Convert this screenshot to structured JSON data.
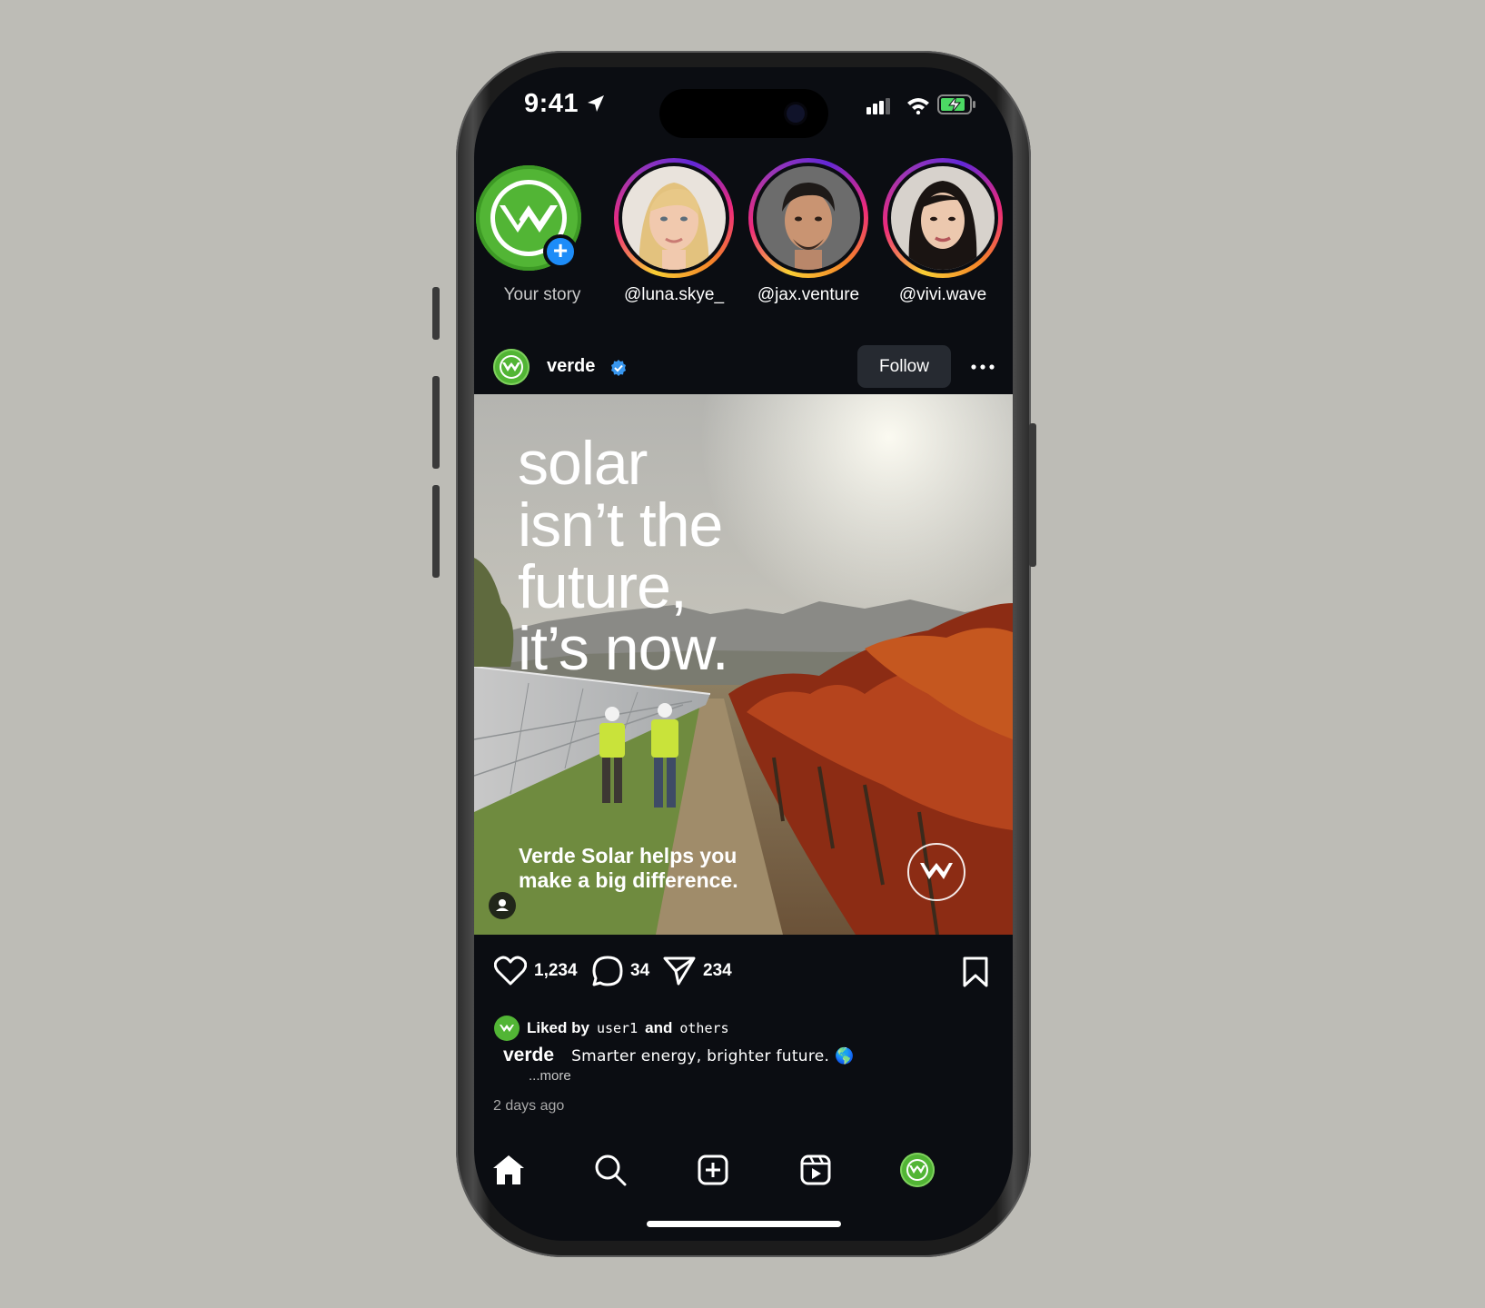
{
  "status_bar": {
    "time": "9:41"
  },
  "stories": [
    {
      "label": "Your story",
      "type": "own"
    },
    {
      "label": "@luna.skye_",
      "type": "friend"
    },
    {
      "label": "@jax.venture",
      "type": "friend"
    },
    {
      "label": "@vivi.wave",
      "type": "friend"
    }
  ],
  "post": {
    "username": "verde",
    "verified": true,
    "follow_label": "Follow",
    "headline": [
      "solar",
      "isn’t the",
      "future,",
      "it’s now."
    ],
    "subheadline": [
      "Verde Solar helps you",
      "make a big difference."
    ],
    "likes": "1,234",
    "comments": "34",
    "shares": "234",
    "liked_by_prefix": "Liked by",
    "liked_by_user": "user1",
    "liked_by_and": "and",
    "liked_by_suffix": "others",
    "caption_user": "verde",
    "caption_text": "Smarter energy, brighter future. 🌎",
    "more_label": "...more",
    "timestamp": "2 days ago"
  },
  "colors": {
    "brand_green": "#52b535",
    "accent_blue": "#1d8cf8",
    "background": "#0b0d12"
  },
  "nav": [
    "home-icon",
    "search-icon",
    "create-icon",
    "reels-icon",
    "profile-avatar"
  ]
}
